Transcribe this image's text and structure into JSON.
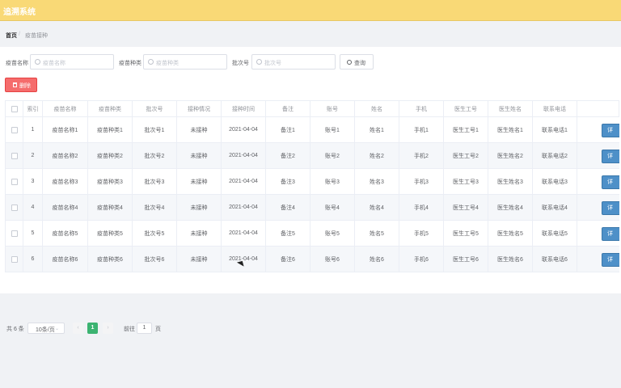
{
  "app": {
    "title": "追溯系统"
  },
  "breadcrumb": {
    "home": "首页",
    "separator": "/",
    "current": "疫苗接种"
  },
  "search": {
    "fields": [
      {
        "label": "疫苗名称",
        "placeholder": "疫苗名称"
      },
      {
        "label": "疫苗种类",
        "placeholder": "疫苗种类"
      },
      {
        "label": "批次号",
        "placeholder": "批次号"
      }
    ],
    "query_label": "查询"
  },
  "toolbar": {
    "delete_label": "删除"
  },
  "table": {
    "headers": [
      "索引",
      "疫苗名称",
      "疫苗种类",
      "批次号",
      "接种情况",
      "接种时间",
      "备注",
      "账号",
      "姓名",
      "手机",
      "医生工号",
      "医生姓名",
      "联系电话"
    ],
    "action_label": "详",
    "rows": [
      [
        "1",
        "疫苗名称1",
        "疫苗种类1",
        "批次号1",
        "未接种",
        "2021-04-04",
        "备注1",
        "账号1",
        "姓名1",
        "手机1",
        "医生工号1",
        "医生姓名1",
        "联系电话1"
      ],
      [
        "2",
        "疫苗名称2",
        "疫苗种类2",
        "批次号2",
        "未接种",
        "2021-04-04",
        "备注2",
        "账号2",
        "姓名2",
        "手机2",
        "医生工号2",
        "医生姓名2",
        "联系电话2"
      ],
      [
        "3",
        "疫苗名称3",
        "疫苗种类3",
        "批次号3",
        "未接种",
        "2021-04-04",
        "备注3",
        "账号3",
        "姓名3",
        "手机3",
        "医生工号3",
        "医生姓名3",
        "联系电话3"
      ],
      [
        "4",
        "疫苗名称4",
        "疫苗种类4",
        "批次号4",
        "未接种",
        "2021-04-04",
        "备注4",
        "账号4",
        "姓名4",
        "手机4",
        "医生工号4",
        "医生姓名4",
        "联系电话4"
      ],
      [
        "5",
        "疫苗名称5",
        "疫苗种类5",
        "批次号5",
        "未接种",
        "2021-04-04",
        "备注5",
        "账号5",
        "姓名5",
        "手机5",
        "医生工号5",
        "医生姓名5",
        "联系电话5"
      ],
      [
        "6",
        "疫苗名称6",
        "疫苗种类6",
        "批次号6",
        "未接种",
        "2021-04-04",
        "备注6",
        "账号6",
        "姓名6",
        "手机6",
        "医生工号6",
        "医生姓名6",
        "联系电话6"
      ]
    ]
  },
  "pagination": {
    "total": "共 6 条",
    "page_size": "10条/页",
    "prev": "‹",
    "next": "›",
    "current_page": "1",
    "jump_prefix": "前往",
    "jump_value": "1",
    "jump_suffix": "页"
  },
  "colors": {
    "header_bar": "#f9d976",
    "delete": "#f56c6c",
    "active_page": "#3cb371",
    "action": "#4e90c8"
  }
}
